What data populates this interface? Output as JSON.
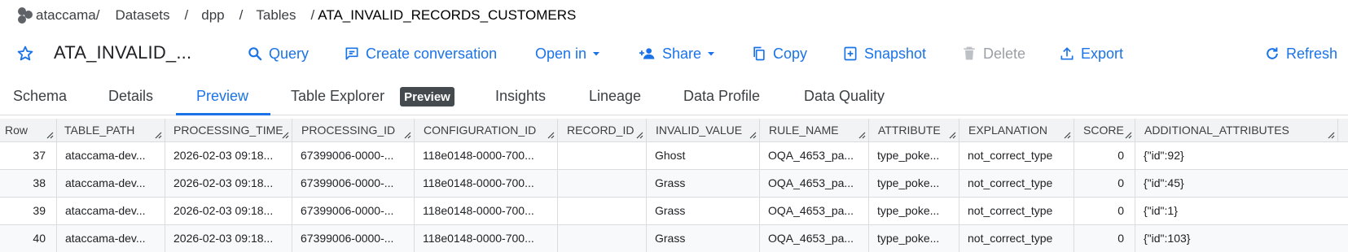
{
  "breadcrumb": {
    "brand": "ataccama",
    "items": [
      "Datasets",
      "dpp",
      "Tables"
    ],
    "separator": "/",
    "current": "ATA_INVALID_RECORDS_CUSTOMERS"
  },
  "toolbar": {
    "table_title": "ATA_INVALID_...",
    "query": "Query",
    "create_conversation": "Create conversation",
    "open_in": "Open in",
    "share": "Share",
    "copy": "Copy",
    "snapshot": "Snapshot",
    "delete": "Delete",
    "export": "Export",
    "refresh": "Refresh"
  },
  "tabs": {
    "schema": "Schema",
    "details": "Details",
    "preview": "Preview",
    "table_explorer": "Table Explorer",
    "table_explorer_badge": "Preview",
    "insights": "Insights",
    "lineage": "Lineage",
    "data_profile": "Data Profile",
    "data_quality": "Data Quality",
    "active": "Preview"
  },
  "grid": {
    "columns": [
      "Row",
      "TABLE_PATH",
      "PROCESSING_TIME",
      "PROCESSING_ID",
      "CONFIGURATION_ID",
      "RECORD_ID",
      "INVALID_VALUE",
      "RULE_NAME",
      "ATTRIBUTE",
      "EXPLANATION",
      "SCORE",
      "ADDITIONAL_ATTRIBUTES"
    ],
    "rows": [
      [
        "37",
        "ataccama-dev...",
        "2026-02-03 09:18...",
        "67399006-0000-...",
        "118e0148-0000-700...",
        "",
        "Ghost",
        "OQA_4653_pa...",
        "type_poke...",
        "not_correct_type",
        "0",
        "{\"id\":92}"
      ],
      [
        "38",
        "ataccama-dev...",
        "2026-02-03 09:18...",
        "67399006-0000-...",
        "118e0148-0000-700...",
        "",
        "Grass",
        "OQA_4653_pa...",
        "type_poke...",
        "not_correct_type",
        "0",
        "{\"id\":45}"
      ],
      [
        "39",
        "ataccama-dev...",
        "2026-02-03 09:18...",
        "67399006-0000-...",
        "118e0148-0000-700...",
        "",
        "Grass",
        "OQA_4653_pa...",
        "type_poke...",
        "not_correct_type",
        "0",
        "{\"id\":1}"
      ],
      [
        "40",
        "ataccama-dev...",
        "2026-02-03 09:18...",
        "67399006-0000-...",
        "118e0148-0000-700...",
        "",
        "Grass",
        "OQA_4653_pa...",
        "type_poke...",
        "not_correct_type",
        "0",
        "{\"id\":103}"
      ]
    ]
  },
  "colors": {
    "accent": "#1a73e8",
    "disabled": "#9aa0a6",
    "badge_bg": "#444a4e",
    "header_bg": "#f1f3f4"
  }
}
